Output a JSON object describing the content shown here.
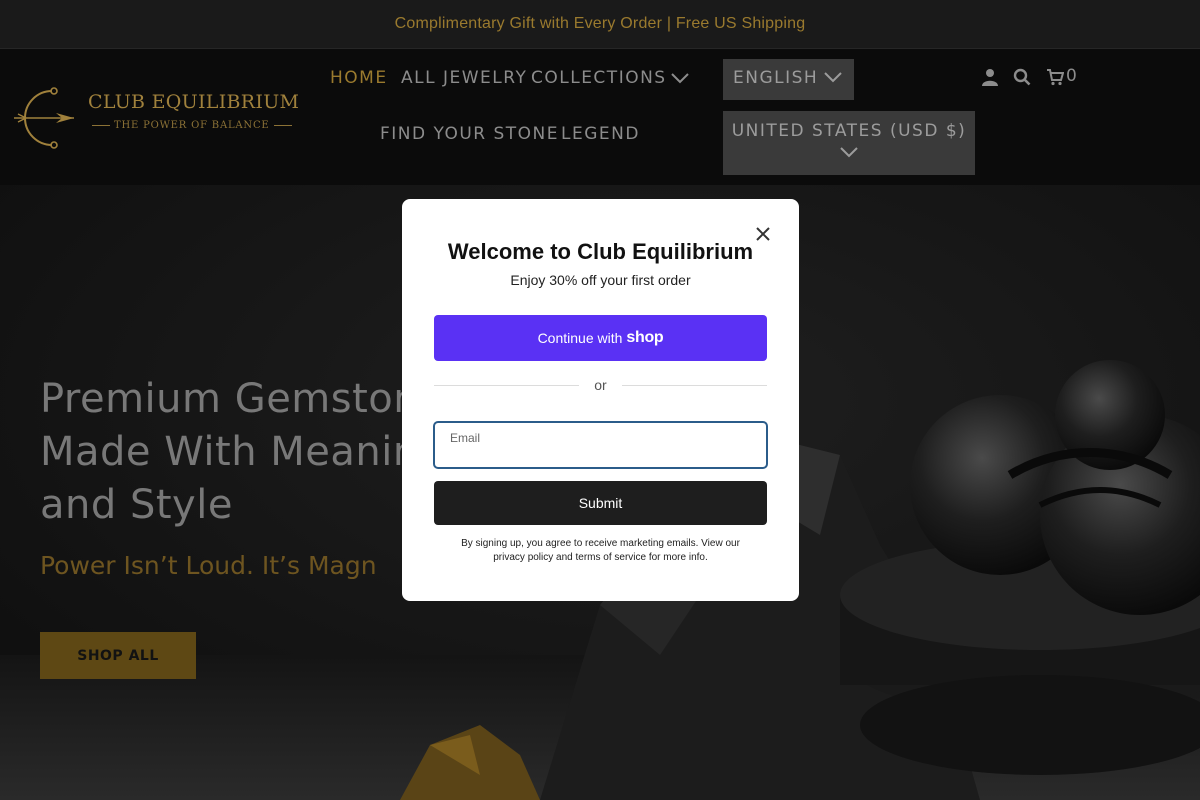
{
  "announcement": "Complimentary Gift with Every Order | Free US Shipping",
  "logo": {
    "brand": "CLUB EQUILIBRIUM",
    "tagline": "THE POWER OF BALANCE"
  },
  "nav": {
    "home": "HOME",
    "all_jewelry": "ALL JEWELRY",
    "collections": "COLLECTIONS",
    "find_your_stone": "FIND YOUR STONE",
    "legend": "LEGEND"
  },
  "selectors": {
    "language": "ENGLISH",
    "country": "UNITED STATES (USD $)"
  },
  "cart": {
    "count": "0"
  },
  "hero": {
    "title_line1": "Premium Gemstone",
    "title_line2": "Made With Meaning",
    "title_line3": "and Style",
    "subtitle": "Power Isn’t Loud. It’s Magn",
    "cta": "SHOP ALL"
  },
  "popup": {
    "title": "Welcome to Club Equilibrium",
    "subtitle": "Enjoy 30% off your first order",
    "shop_button_prefix": "Continue with",
    "shop_button_brand": "shop",
    "or_text": "or",
    "email_label": "Email",
    "email_value": "",
    "submit_label": "Submit",
    "legal": "By signing up, you agree to receive marketing emails. View our privacy policy and terms of service for more info."
  },
  "colors": {
    "gold": "#9a7a2e",
    "shop_purple": "#5a31f4",
    "header_bg": "#0b0b0b",
    "selector_bg": "#3a3a3a"
  },
  "icons": [
    "close-icon",
    "chevron-down-icon",
    "user-icon",
    "search-icon",
    "cart-icon",
    "logo-arrow-icon"
  ]
}
